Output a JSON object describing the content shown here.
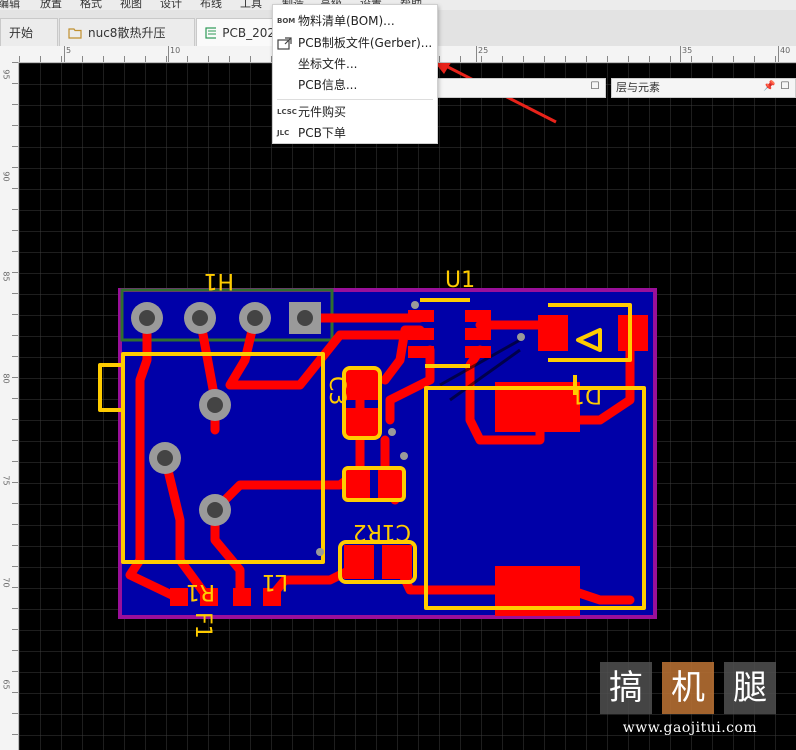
{
  "menubar": [
    "编辑",
    "放置",
    "格式",
    "视图",
    "设计",
    "布线",
    "工具",
    "制造",
    "高级",
    "设置",
    "帮助"
  ],
  "tabs": [
    {
      "label": "开始"
    },
    {
      "label": "nuc8散热升压"
    },
    {
      "label": "PCB_202"
    }
  ],
  "ruler_h": [
    "5",
    "10",
    "25",
    "35",
    "40"
  ],
  "ruler_v": [
    "95",
    "90",
    "85",
    "80",
    "75",
    "70",
    "65"
  ],
  "panels": {
    "layers_title": "层与元素"
  },
  "menu": {
    "items": [
      {
        "icon": "BOM",
        "label": "物料清单(BOM)..."
      },
      {
        "icon": "gerber",
        "label": "PCB制板文件(Gerber)..."
      },
      {
        "icon": "",
        "label": "坐标文件..."
      },
      {
        "icon": "",
        "label": "PCB信息..."
      },
      {
        "icon": "LCSC",
        "label": "元件购买"
      },
      {
        "icon": "JLC",
        "label": "PCB下单"
      }
    ]
  },
  "pcb": {
    "designators": [
      "H1",
      "U1",
      "C3",
      "R2",
      "R1",
      "F1",
      "D1",
      "L1",
      "C1"
    ]
  },
  "watermark": {
    "chars": [
      "搞",
      "机",
      "腿"
    ],
    "url": "www.gaojitui.com"
  },
  "colors": {
    "board_fill": "#0000a8",
    "copper": "#ff0000",
    "silk": "#ffcc00",
    "outline": "#9a0f9a",
    "h1_silk": "#2f6f2f",
    "arrow": "#e8231a"
  }
}
